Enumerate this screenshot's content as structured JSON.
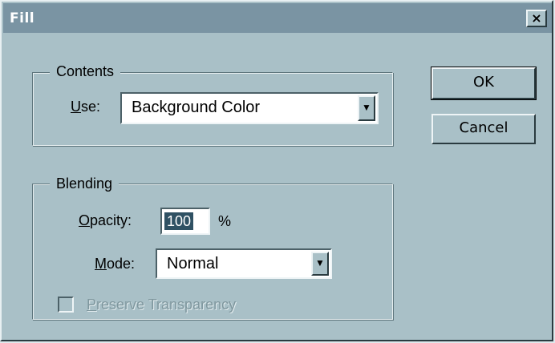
{
  "window": {
    "title": "Fill",
    "close_glyph": "×"
  },
  "contents": {
    "group_label": "Contents",
    "use_label_mnemonic": "U",
    "use_label_rest": "se:",
    "use_value": "Background Color"
  },
  "blending": {
    "group_label": "Blending",
    "opacity_label_mnemonic": "O",
    "opacity_label_rest": "pacity:",
    "opacity_value": "100",
    "opacity_unit": "%",
    "mode_label_mnemonic": "M",
    "mode_label_rest": "ode:",
    "mode_value": "Normal",
    "preserve_mnemonic": "P",
    "preserve_rest": "reserve Transparency",
    "preserve_checked": false,
    "preserve_enabled": false
  },
  "buttons": {
    "ok_label": "OK",
    "cancel_label": "Cancel"
  },
  "icons": {
    "dropdown_arrow": "▼"
  },
  "colors": {
    "dialog_face": "#a9c0c7",
    "titlebar": "#7a94a3",
    "selection": "#2f5163"
  }
}
